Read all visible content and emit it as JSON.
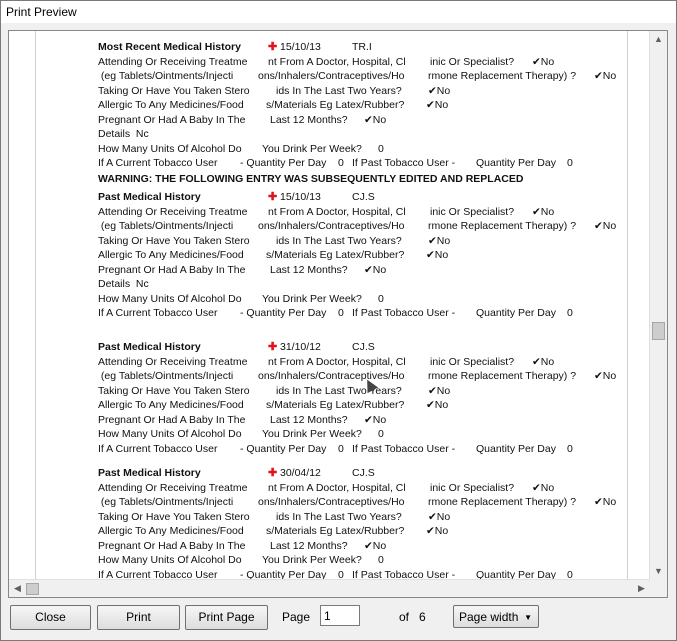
{
  "window": {
    "title": "Print Preview"
  },
  "records": [
    {
      "heading": "Most Recent Medical History",
      "date": "15/10/13",
      "author": "TR.I",
      "lines": [
        {
          "parts": [
            [
              "Attending Or Receiving Treatme",
              0
            ],
            [
              "nt From A Doctor, Hospital, Cl",
              170
            ],
            [
              "inic Or Specialist?",
              332
            ],
            [
              "✔No",
              434
            ]
          ]
        },
        {
          "parts": [
            [
              " (eg Tablets/Ointments/Injecti",
              0
            ],
            [
              "ons/Inhalers/Contraceptives/Ho",
              160
            ],
            [
              "rmone Replacement Therapy) ?",
              330
            ],
            [
              "✔No",
              496
            ]
          ]
        },
        {
          "parts": [
            [
              "Taking Or Have You Taken Stero",
              0
            ],
            [
              "ids In The Last Two Years?",
              178
            ],
            [
              "✔No",
              330
            ]
          ]
        },
        {
          "parts": [
            [
              "Allergic To Any Medicines/Food",
              0
            ],
            [
              "s/Materials Eg Latex/Rubber?",
              168
            ],
            [
              "✔No",
              328
            ]
          ]
        },
        {
          "parts": [
            [
              "Pregnant Or Had A Baby In The",
              0
            ],
            [
              "Last 12 Months?",
              172
            ],
            [
              "✔No",
              266
            ]
          ]
        },
        {
          "parts": [
            [
              "Details  Nc",
              0
            ]
          ]
        },
        {
          "parts": [
            [
              "How Many Units Of Alcohol Do",
              0
            ],
            [
              "You Drink Per Week?",
              164
            ],
            [
              "0",
              280
            ]
          ]
        },
        {
          "parts": [
            [
              "If A Current Tobacco User",
              0
            ],
            [
              "- Quantity Per Day",
              142
            ],
            [
              "0",
              240
            ],
            [
              "If Past Tobacco User -",
              254
            ],
            [
              "Quantity Per Day",
              378
            ],
            [
              "0",
              469
            ]
          ]
        }
      ]
    },
    {
      "warning": "WARNING: THE FOLLOWING ENTRY WAS SUBSEQUENTLY EDITED AND REPLACED",
      "heading": "Past Medical History",
      "date": "15/10/13",
      "author": "CJ.S",
      "lines": [
        {
          "parts": [
            [
              "Attending Or Receiving Treatme",
              0
            ],
            [
              "nt From A Doctor, Hospital, Cl",
              170
            ],
            [
              "inic Or Specialist?",
              332
            ],
            [
              "✔No",
              434
            ]
          ]
        },
        {
          "parts": [
            [
              " (eg Tablets/Ointments/Injecti",
              0
            ],
            [
              "ons/Inhalers/Contraceptives/Ho",
              160
            ],
            [
              "rmone Replacement Therapy) ?",
              330
            ],
            [
              "✔No",
              496
            ]
          ]
        },
        {
          "parts": [
            [
              "Taking Or Have You Taken Stero",
              0
            ],
            [
              "ids In The Last Two Years?",
              178
            ],
            [
              "✔No",
              330
            ]
          ]
        },
        {
          "parts": [
            [
              "Allergic To Any Medicines/Food",
              0
            ],
            [
              "s/Materials Eg Latex/Rubber?",
              168
            ],
            [
              "✔No",
              328
            ]
          ]
        },
        {
          "parts": [
            [
              "Pregnant Or Had A Baby In The",
              0
            ],
            [
              "Last 12 Months?",
              172
            ],
            [
              "✔No",
              266
            ]
          ]
        },
        {
          "parts": [
            [
              "Details  Nc",
              0
            ]
          ]
        },
        {
          "parts": [
            [
              "How Many Units Of Alcohol Do",
              0
            ],
            [
              "You Drink Per Week?",
              164
            ],
            [
              "0",
              280
            ]
          ]
        },
        {
          "parts": [
            [
              "If A Current Tobacco User",
              0
            ],
            [
              "- Quantity Per Day",
              142
            ],
            [
              "0",
              240
            ],
            [
              "If Past Tobacco User -",
              254
            ],
            [
              "Quantity Per Day",
              378
            ],
            [
              "0",
              469
            ]
          ]
        }
      ]
    },
    {
      "heading": "Past Medical History",
      "date": "31/10/12",
      "author": "CJ.S",
      "lines": [
        {
          "parts": [
            [
              "Attending Or Receiving Treatme",
              0
            ],
            [
              "nt From A Doctor, Hospital, Cl",
              170
            ],
            [
              "inic Or Specialist?",
              332
            ],
            [
              "✔No",
              434
            ]
          ]
        },
        {
          "parts": [
            [
              " (eg Tablets/Ointments/Injecti",
              0
            ],
            [
              "ons/Inhalers/Contraceptives/Ho",
              160
            ],
            [
              "rmone Replacement Therapy) ?",
              330
            ],
            [
              "✔No",
              496
            ]
          ]
        },
        {
          "parts": [
            [
              "Taking Or Have You Taken Stero",
              0
            ],
            [
              "ids In The Last Two Years?",
              178
            ],
            [
              "✔No",
              330
            ]
          ]
        },
        {
          "parts": [
            [
              "Allergic To Any Medicines/Food",
              0
            ],
            [
              "s/Materials Eg Latex/Rubber?",
              168
            ],
            [
              "✔No",
              328
            ]
          ]
        },
        {
          "parts": [
            [
              "Pregnant Or Had A Baby In The",
              0
            ],
            [
              "Last 12 Months?",
              172
            ],
            [
              "✔No",
              266
            ]
          ]
        },
        {
          "parts": [
            [
              "How Many Units Of Alcohol Do",
              0
            ],
            [
              "You Drink Per Week?",
              164
            ],
            [
              "0",
              280
            ]
          ]
        },
        {
          "parts": [
            [
              "If A Current Tobacco User",
              0
            ],
            [
              "- Quantity Per Day",
              142
            ],
            [
              "0",
              240
            ],
            [
              "If Past Tobacco User -",
              254
            ],
            [
              "Quantity Per Day",
              378
            ],
            [
              "0",
              469
            ]
          ]
        }
      ]
    },
    {
      "heading": "Past Medical History",
      "date": "30/04/12",
      "author": "CJ.S",
      "lines": [
        {
          "parts": [
            [
              "Attending Or Receiving Treatme",
              0
            ],
            [
              "nt From A Doctor, Hospital, Cl",
              170
            ],
            [
              "inic Or Specialist?",
              332
            ],
            [
              "✔No",
              434
            ]
          ]
        },
        {
          "parts": [
            [
              " (eg Tablets/Ointments/Injecti",
              0
            ],
            [
              "ons/Inhalers/Contraceptives/Ho",
              160
            ],
            [
              "rmone Replacement Therapy) ?",
              330
            ],
            [
              "✔No",
              496
            ]
          ]
        },
        {
          "parts": [
            [
              "Taking Or Have You Taken Stero",
              0
            ],
            [
              "ids In The Last Two Years?",
              178
            ],
            [
              "✔No",
              330
            ]
          ]
        },
        {
          "parts": [
            [
              "Allergic To Any Medicines/Food",
              0
            ],
            [
              "s/Materials Eg Latex/Rubber?",
              168
            ],
            [
              "✔No",
              328
            ]
          ]
        },
        {
          "parts": [
            [
              "Pregnant Or Had A Baby In The",
              0
            ],
            [
              "Last 12 Months?",
              172
            ],
            [
              "✔No",
              266
            ]
          ]
        },
        {
          "parts": [
            [
              "How Many Units Of Alcohol Do",
              0
            ],
            [
              "You Drink Per Week?",
              164
            ],
            [
              "0",
              280
            ]
          ]
        },
        {
          "parts": [
            [
              "If A Current Tobacco User",
              0
            ],
            [
              "- Quantity Per Day",
              142
            ],
            [
              "0",
              240
            ],
            [
              "If Past Tobacco User -",
              254
            ],
            [
              "Quantity Per Day",
              378
            ],
            [
              "0",
              469
            ]
          ]
        }
      ]
    }
  ],
  "toolbar": {
    "close_label": "Close",
    "print_label": "Print",
    "print_page_label": "Print Page",
    "page_label": "Page",
    "page_value": "1",
    "of_label": "of",
    "total_pages": "6",
    "zoom_value": "Page width"
  }
}
